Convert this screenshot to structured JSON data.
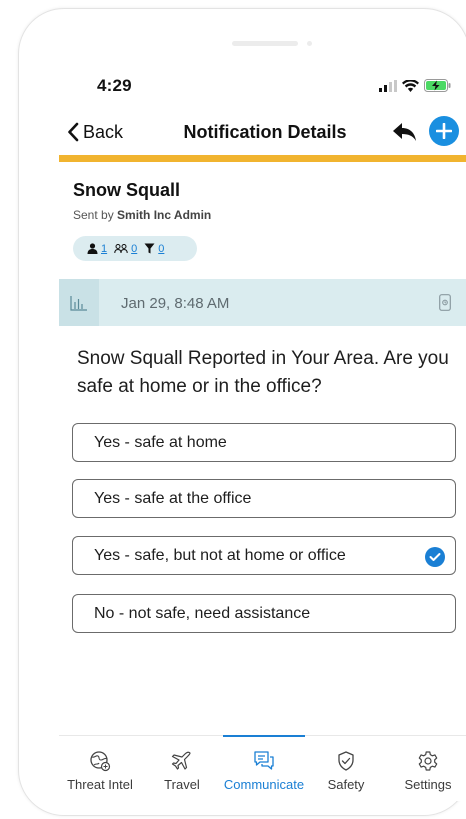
{
  "status_bar": {
    "time": "4:29"
  },
  "nav": {
    "back_label": "Back",
    "title": "Notification Details"
  },
  "notification": {
    "title": "Snow Squall",
    "sent_by_prefix": "Sent by ",
    "sent_by_name": "Smith Inc Admin",
    "counts": {
      "users": "1",
      "groups": "0",
      "filters": "0"
    },
    "date": "Jan 29, 8:48 AM",
    "message": "Snow Squall Reported in Your Area. Are you safe at home or in the office?"
  },
  "options": [
    {
      "label": "Yes - safe at home",
      "selected": false
    },
    {
      "label": "Yes - safe at the office",
      "selected": false
    },
    {
      "label": "Yes - safe, but not at home or office",
      "selected": true
    },
    {
      "label": "No - not safe, need assistance",
      "selected": false
    }
  ],
  "tabs": [
    {
      "label": "Threat Intel",
      "icon": "globe-icon",
      "active": false
    },
    {
      "label": "Travel",
      "icon": "plane-icon",
      "active": false
    },
    {
      "label": "Communicate",
      "icon": "chat-icon",
      "active": true
    },
    {
      "label": "Safety",
      "icon": "shield-icon",
      "active": false
    },
    {
      "label": "Settings",
      "icon": "gear-icon",
      "active": false
    }
  ],
  "colors": {
    "accent_bar": "#f1b42f",
    "primary": "#1a7fd4",
    "band": "#daecef"
  }
}
